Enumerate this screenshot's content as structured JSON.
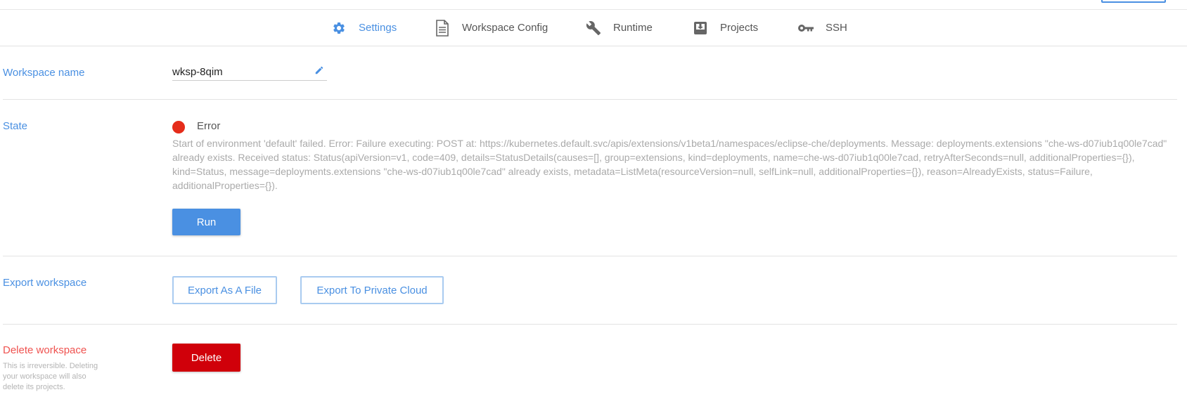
{
  "tabs": [
    {
      "label": "Settings",
      "icon": "gear-icon",
      "active": true
    },
    {
      "label": "Workspace Config",
      "icon": "document-icon",
      "active": false
    },
    {
      "label": "Runtime",
      "icon": "wrench-icon",
      "active": false
    },
    {
      "label": "Projects",
      "icon": "download-box-icon",
      "active": false
    },
    {
      "label": "SSH",
      "icon": "key-icon",
      "active": false
    }
  ],
  "workspace_name": {
    "label": "Workspace name",
    "value": "wksp-8qim"
  },
  "state": {
    "label": "State",
    "status": "Error",
    "message": "Start of environment 'default' failed. Error: Failure executing: POST at: https://kubernetes.default.svc/apis/extensions/v1beta1/namespaces/eclipse-che/deployments. Message: deployments.extensions \"che-ws-d07iub1q00le7cad\" already exists. Received status: Status(apiVersion=v1, code=409, details=StatusDetails(causes=[], group=extensions, kind=deployments, name=che-ws-d07iub1q00le7cad, retryAfterSeconds=null, additionalProperties={}), kind=Status, message=deployments.extensions \"che-ws-d07iub1q00le7cad\" already exists, metadata=ListMeta(resourceVersion=null, selfLink=null, additionalProperties={}), reason=AlreadyExists, status=Failure, additionalProperties={}).",
    "run_label": "Run"
  },
  "export": {
    "label": "Export workspace",
    "file_label": "Export As A File",
    "cloud_label": "Export To Private Cloud"
  },
  "delete": {
    "label": "Delete workspace",
    "help": "This is irreversible. Deleting your workspace will also delete its projects.",
    "button_label": "Delete"
  },
  "colors": {
    "accent": "#4a90e2",
    "error": "#e52c1a",
    "danger": "#d0000a"
  }
}
